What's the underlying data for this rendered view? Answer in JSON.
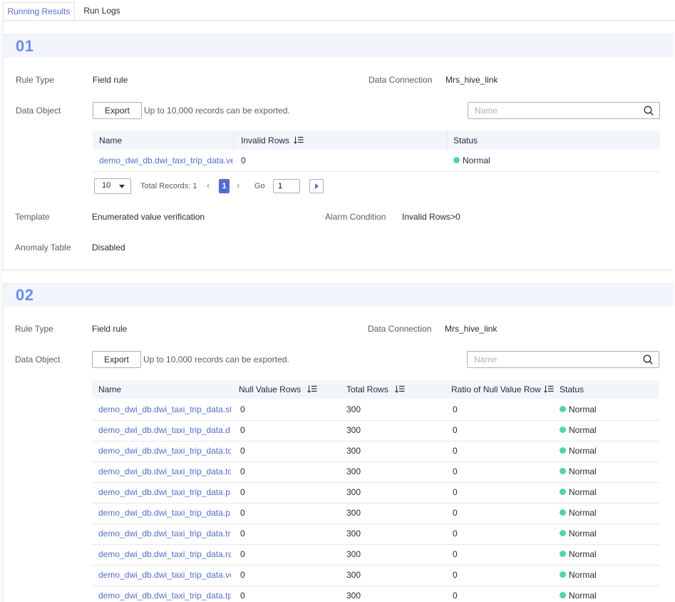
{
  "tabs": [
    {
      "label": "Running Results",
      "active": true
    },
    {
      "label": "Run Logs",
      "active": false
    }
  ],
  "labels": {
    "rule_type": "Rule Type",
    "data_connection": "Data Connection",
    "data_object": "Data Object",
    "template": "Template",
    "alarm_condition": "Alarm Condition",
    "anomaly_table": "Anomaly Table",
    "export": "Export",
    "export_hint": "Up to 10,000 records can be exported.",
    "search_placeholder": "Name"
  },
  "section1": {
    "number": "01",
    "rule_type": "Field rule",
    "data_connection": "Mrs_hive_link",
    "table": {
      "columns": [
        "Name",
        "Invalid Rows",
        "Status"
      ],
      "rows": [
        {
          "name": "demo_dwi_db.dwi_taxi_trip_data.ve...",
          "invalid_rows": "0",
          "status": "Normal"
        }
      ]
    },
    "pagination": {
      "page_size": "10",
      "total": "Total Records: 1",
      "current_page": "1",
      "go_label": "Go",
      "go_value": "1"
    },
    "template": "Enumerated value verification",
    "alarm_condition": "Invalid Rows>0",
    "anomaly_table": "Disabled"
  },
  "section2": {
    "number": "02",
    "rule_type": "Field rule",
    "data_connection": "Mrs_hive_link",
    "table": {
      "columns": [
        "Name",
        "Null Value Rows",
        "Total Rows",
        "Ratio of Null Value Row",
        "Status"
      ],
      "rows": [
        {
          "name": "demo_dwi_db.dwi_taxi_trip_data.st...",
          "null_rows": "0",
          "total_rows": "300",
          "ratio": "0",
          "status": "Normal"
        },
        {
          "name": "demo_dwi_db.dwi_taxi_trip_data.d...",
          "null_rows": "0",
          "total_rows": "300",
          "ratio": "0",
          "status": "Normal"
        },
        {
          "name": "demo_dwi_db.dwi_taxi_trip_data.to...",
          "null_rows": "0",
          "total_rows": "300",
          "ratio": "0",
          "status": "Normal"
        },
        {
          "name": "demo_dwi_db.dwi_taxi_trip_data.to...",
          "null_rows": "0",
          "total_rows": "300",
          "ratio": "0",
          "status": "Normal"
        },
        {
          "name": "demo_dwi_db.dwi_taxi_trip_data.p...",
          "null_rows": "0",
          "total_rows": "300",
          "ratio": "0",
          "status": "Normal"
        },
        {
          "name": "demo_dwi_db.dwi_taxi_trip_data.p...",
          "null_rows": "0",
          "total_rows": "300",
          "ratio": "0",
          "status": "Normal"
        },
        {
          "name": "demo_dwi_db.dwi_taxi_trip_data.tri...",
          "null_rows": "0",
          "total_rows": "300",
          "ratio": "0",
          "status": "Normal"
        },
        {
          "name": "demo_dwi_db.dwi_taxi_trip_data.ra...",
          "null_rows": "0",
          "total_rows": "300",
          "ratio": "0",
          "status": "Normal"
        },
        {
          "name": "demo_dwi_db.dwi_taxi_trip_data.ve...",
          "null_rows": "0",
          "total_rows": "300",
          "ratio": "0",
          "status": "Normal"
        },
        {
          "name": "demo_dwi_db.dwi_taxi_trip_data.tp...",
          "null_rows": "0",
          "total_rows": "300",
          "ratio": "0",
          "status": "Normal"
        }
      ]
    }
  },
  "colors": {
    "accent": "#526ecc",
    "section_number": "#6c8ee6",
    "status_normal": "#50d4ab",
    "header_bg": "#f3f5fc"
  },
  "icons": {
    "search": "search-icon",
    "sort": "sort-icon",
    "status": "status-dot-icon"
  }
}
